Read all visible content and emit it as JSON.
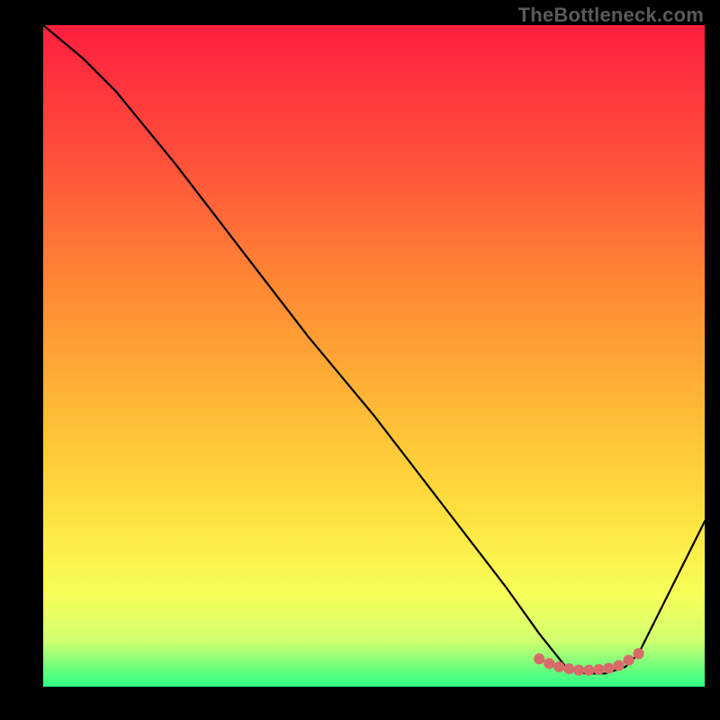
{
  "watermark": "TheBottleneck.com",
  "chart_data": {
    "type": "line",
    "title": "",
    "xlabel": "",
    "ylabel": "",
    "xlim": [
      0,
      100
    ],
    "ylim": [
      0,
      100
    ],
    "grid": false,
    "curve_note": "Bottleneck percentage curve; minimum near x≈79–88. Values estimated from pixel positions.",
    "series": [
      {
        "name": "curve",
        "x": [
          0,
          6,
          11,
          20,
          30,
          40,
          50,
          60,
          70,
          75,
          79,
          82,
          85,
          88,
          90,
          92,
          95,
          100
        ],
        "y": [
          100,
          95,
          90,
          79,
          66,
          53,
          41,
          28,
          15,
          8,
          3,
          2,
          2,
          3,
          5,
          9,
          15,
          25
        ]
      },
      {
        "name": "markers",
        "x": [
          75,
          76.5,
          78,
          79.5,
          81,
          82.5,
          84,
          85.5,
          87,
          88.5,
          90
        ],
        "y": [
          4.2,
          3.5,
          3.0,
          2.7,
          2.5,
          2.5,
          2.6,
          2.8,
          3.2,
          4.0,
          5.0
        ]
      }
    ],
    "gradient_stops": [
      {
        "offset": 0.0,
        "color": "#ff1f3f"
      },
      {
        "offset": 0.18,
        "color": "#ff4a3b"
      },
      {
        "offset": 0.4,
        "color": "#ff8a33"
      },
      {
        "offset": 0.58,
        "color": "#ffb936"
      },
      {
        "offset": 0.74,
        "color": "#ffe23e"
      },
      {
        "offset": 0.86,
        "color": "#f7ff59"
      },
      {
        "offset": 0.93,
        "color": "#d1ff6e"
      },
      {
        "offset": 0.965,
        "color": "#7dff7a"
      },
      {
        "offset": 1.0,
        "color": "#2cff87"
      }
    ],
    "colors": {
      "curve": "#000000",
      "marker_fill": "#d86a6a",
      "marker_stroke": "#d86a6a",
      "background_frame": "#000000"
    }
  }
}
